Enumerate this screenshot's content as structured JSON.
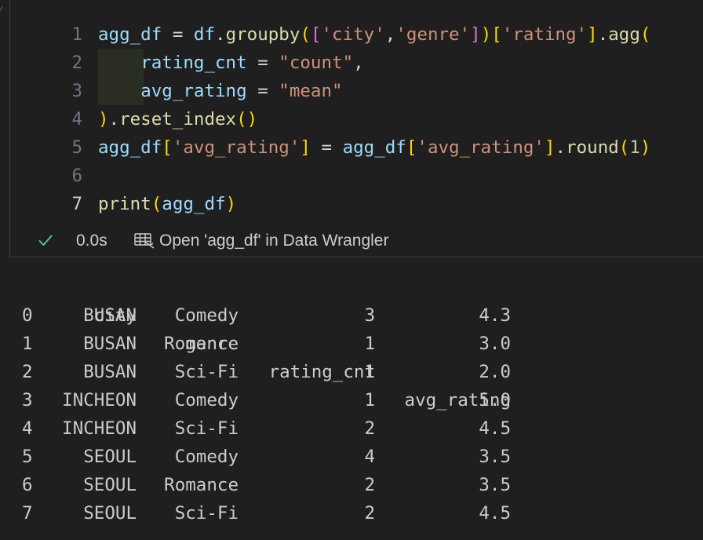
{
  "editor": {
    "lines": [
      {
        "num": "1",
        "tokens": [
          {
            "t": "agg_df",
            "c": "var"
          },
          {
            "t": " = ",
            "c": "op"
          },
          {
            "t": "df",
            "c": "var"
          },
          {
            "t": ".",
            "c": "plain"
          },
          {
            "t": "groupby",
            "c": "fn"
          },
          {
            "t": "(",
            "c": "p1"
          },
          {
            "t": "[",
            "c": "p2"
          },
          {
            "t": "'city'",
            "c": "str"
          },
          {
            "t": ",",
            "c": "plain"
          },
          {
            "t": "'genre'",
            "c": "str"
          },
          {
            "t": "]",
            "c": "p2"
          },
          {
            "t": ")",
            "c": "p1"
          },
          {
            "t": "[",
            "c": "p1"
          },
          {
            "t": "'rating'",
            "c": "str"
          },
          {
            "t": "]",
            "c": "p1"
          },
          {
            "t": ".",
            "c": "plain"
          },
          {
            "t": "agg",
            "c": "fn"
          },
          {
            "t": "(",
            "c": "p1"
          }
        ]
      },
      {
        "num": "2",
        "tokens": [
          {
            "t": "    ",
            "c": "plain"
          },
          {
            "t": "rating_cnt",
            "c": "var"
          },
          {
            "t": " = ",
            "c": "op"
          },
          {
            "t": "\"count\"",
            "c": "str"
          },
          {
            "t": ",",
            "c": "plain"
          }
        ]
      },
      {
        "num": "3",
        "tokens": [
          {
            "t": "    ",
            "c": "plain"
          },
          {
            "t": "avg_rating",
            "c": "var"
          },
          {
            "t": " = ",
            "c": "op"
          },
          {
            "t": "\"mean\"",
            "c": "str"
          }
        ]
      },
      {
        "num": "4",
        "tokens": [
          {
            "t": ")",
            "c": "p1"
          },
          {
            "t": ".",
            "c": "plain"
          },
          {
            "t": "reset_index",
            "c": "fn"
          },
          {
            "t": "()",
            "c": "p1"
          }
        ]
      },
      {
        "num": "5",
        "tokens": [
          {
            "t": "agg_df",
            "c": "var"
          },
          {
            "t": "[",
            "c": "p1"
          },
          {
            "t": "'avg_rating'",
            "c": "str"
          },
          {
            "t": "]",
            "c": "p1"
          },
          {
            "t": " = ",
            "c": "op"
          },
          {
            "t": "agg_df",
            "c": "var"
          },
          {
            "t": "[",
            "c": "p1"
          },
          {
            "t": "'avg_rating'",
            "c": "str"
          },
          {
            "t": "]",
            "c": "p1"
          },
          {
            "t": ".",
            "c": "plain"
          },
          {
            "t": "round",
            "c": "fn"
          },
          {
            "t": "(",
            "c": "p1"
          },
          {
            "t": "1",
            "c": "num"
          },
          {
            "t": ")",
            "c": "p1"
          }
        ]
      },
      {
        "num": "6",
        "tokens": []
      },
      {
        "num": "7",
        "tokens": [
          {
            "t": "print",
            "c": "fn"
          },
          {
            "t": "(",
            "c": "p1"
          },
          {
            "t": "agg_df",
            "c": "var"
          },
          {
            "t": ")",
            "c": "p1"
          }
        ]
      }
    ],
    "active_line": "7"
  },
  "status": {
    "exec_time": "0.0s",
    "wrangler_label": "Open 'agg_df' in Data Wrangler",
    "check_color": "#4ec9b0"
  },
  "output": {
    "headers": {
      "city": "city",
      "genre": "genre",
      "rating_cnt": "rating_cnt",
      "avg_rating": "avg_rating"
    },
    "rows": [
      {
        "idx": "0",
        "city": "BUSAN",
        "genre": "Comedy",
        "rating_cnt": "3",
        "avg_rating": "4.3"
      },
      {
        "idx": "1",
        "city": "BUSAN",
        "genre": "Romance",
        "rating_cnt": "1",
        "avg_rating": "3.0"
      },
      {
        "idx": "2",
        "city": "BUSAN",
        "genre": "Sci-Fi",
        "rating_cnt": "1",
        "avg_rating": "2.0"
      },
      {
        "idx": "3",
        "city": "INCHEON",
        "genre": "Comedy",
        "rating_cnt": "1",
        "avg_rating": "5.0"
      },
      {
        "idx": "4",
        "city": "INCHEON",
        "genre": "Sci-Fi",
        "rating_cnt": "2",
        "avg_rating": "4.5"
      },
      {
        "idx": "5",
        "city": "SEOUL",
        "genre": "Comedy",
        "rating_cnt": "4",
        "avg_rating": "3.5"
      },
      {
        "idx": "6",
        "city": "SEOUL",
        "genre": "Romance",
        "rating_cnt": "2",
        "avg_rating": "3.5"
      },
      {
        "idx": "7",
        "city": "SEOUL",
        "genre": "Sci-Fi",
        "rating_cnt": "2",
        "avg_rating": "4.5"
      }
    ]
  }
}
